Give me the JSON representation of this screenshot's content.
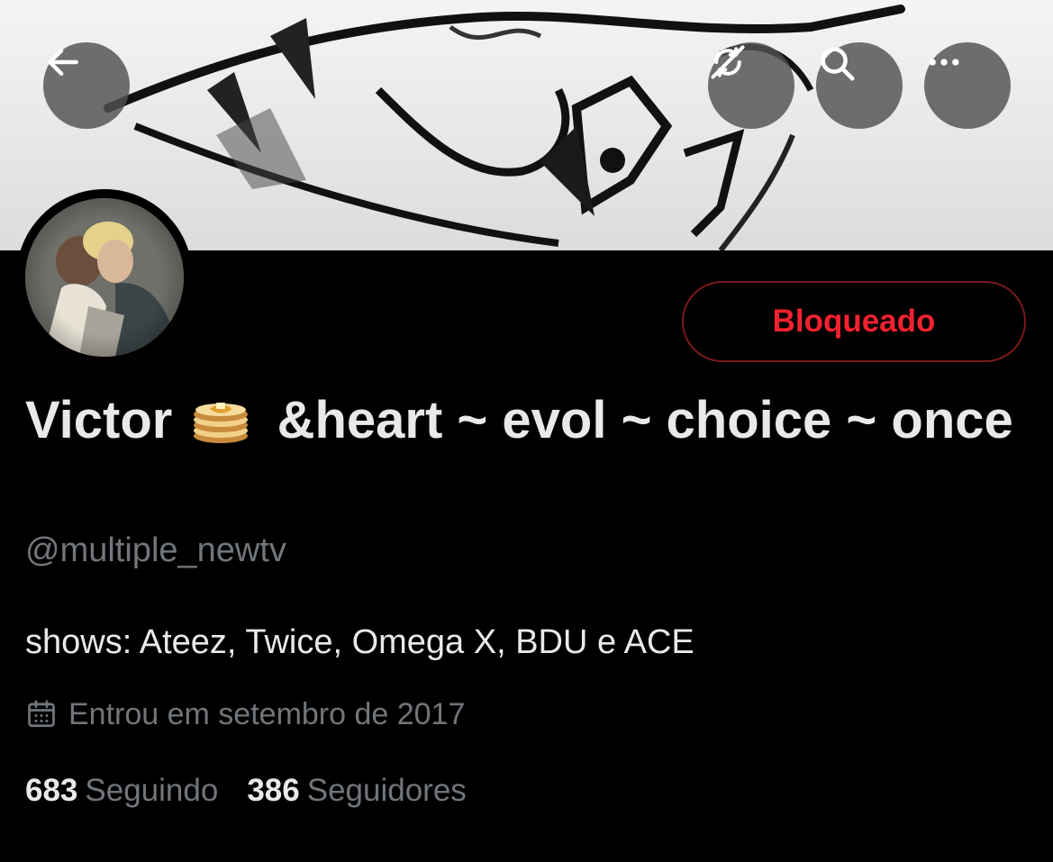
{
  "header": {
    "back_icon": "arrow-left-icon",
    "actions": [
      "sync-slash-icon",
      "search-icon",
      "more-horizontal-icon"
    ]
  },
  "profile": {
    "name_part1": "Victor",
    "name_emoji": "pancakes-icon",
    "name_part2": "&heart ~ evol ~ choice ~ once",
    "handle": "@multiple_newtv",
    "bio": "shows: Ateez, Twice, Omega X, BDU e ACE",
    "joined": "Entrou em setembro de 2017",
    "blocked_label": "Bloqueado"
  },
  "stats": {
    "following_count": "683",
    "following_label": "Seguindo",
    "followers_count": "386",
    "followers_label": "Seguidores"
  },
  "colors": {
    "background": "#000000",
    "text_primary": "#e7e9ea",
    "text_secondary": "#71767b",
    "blocked_red": "#f4212e"
  }
}
